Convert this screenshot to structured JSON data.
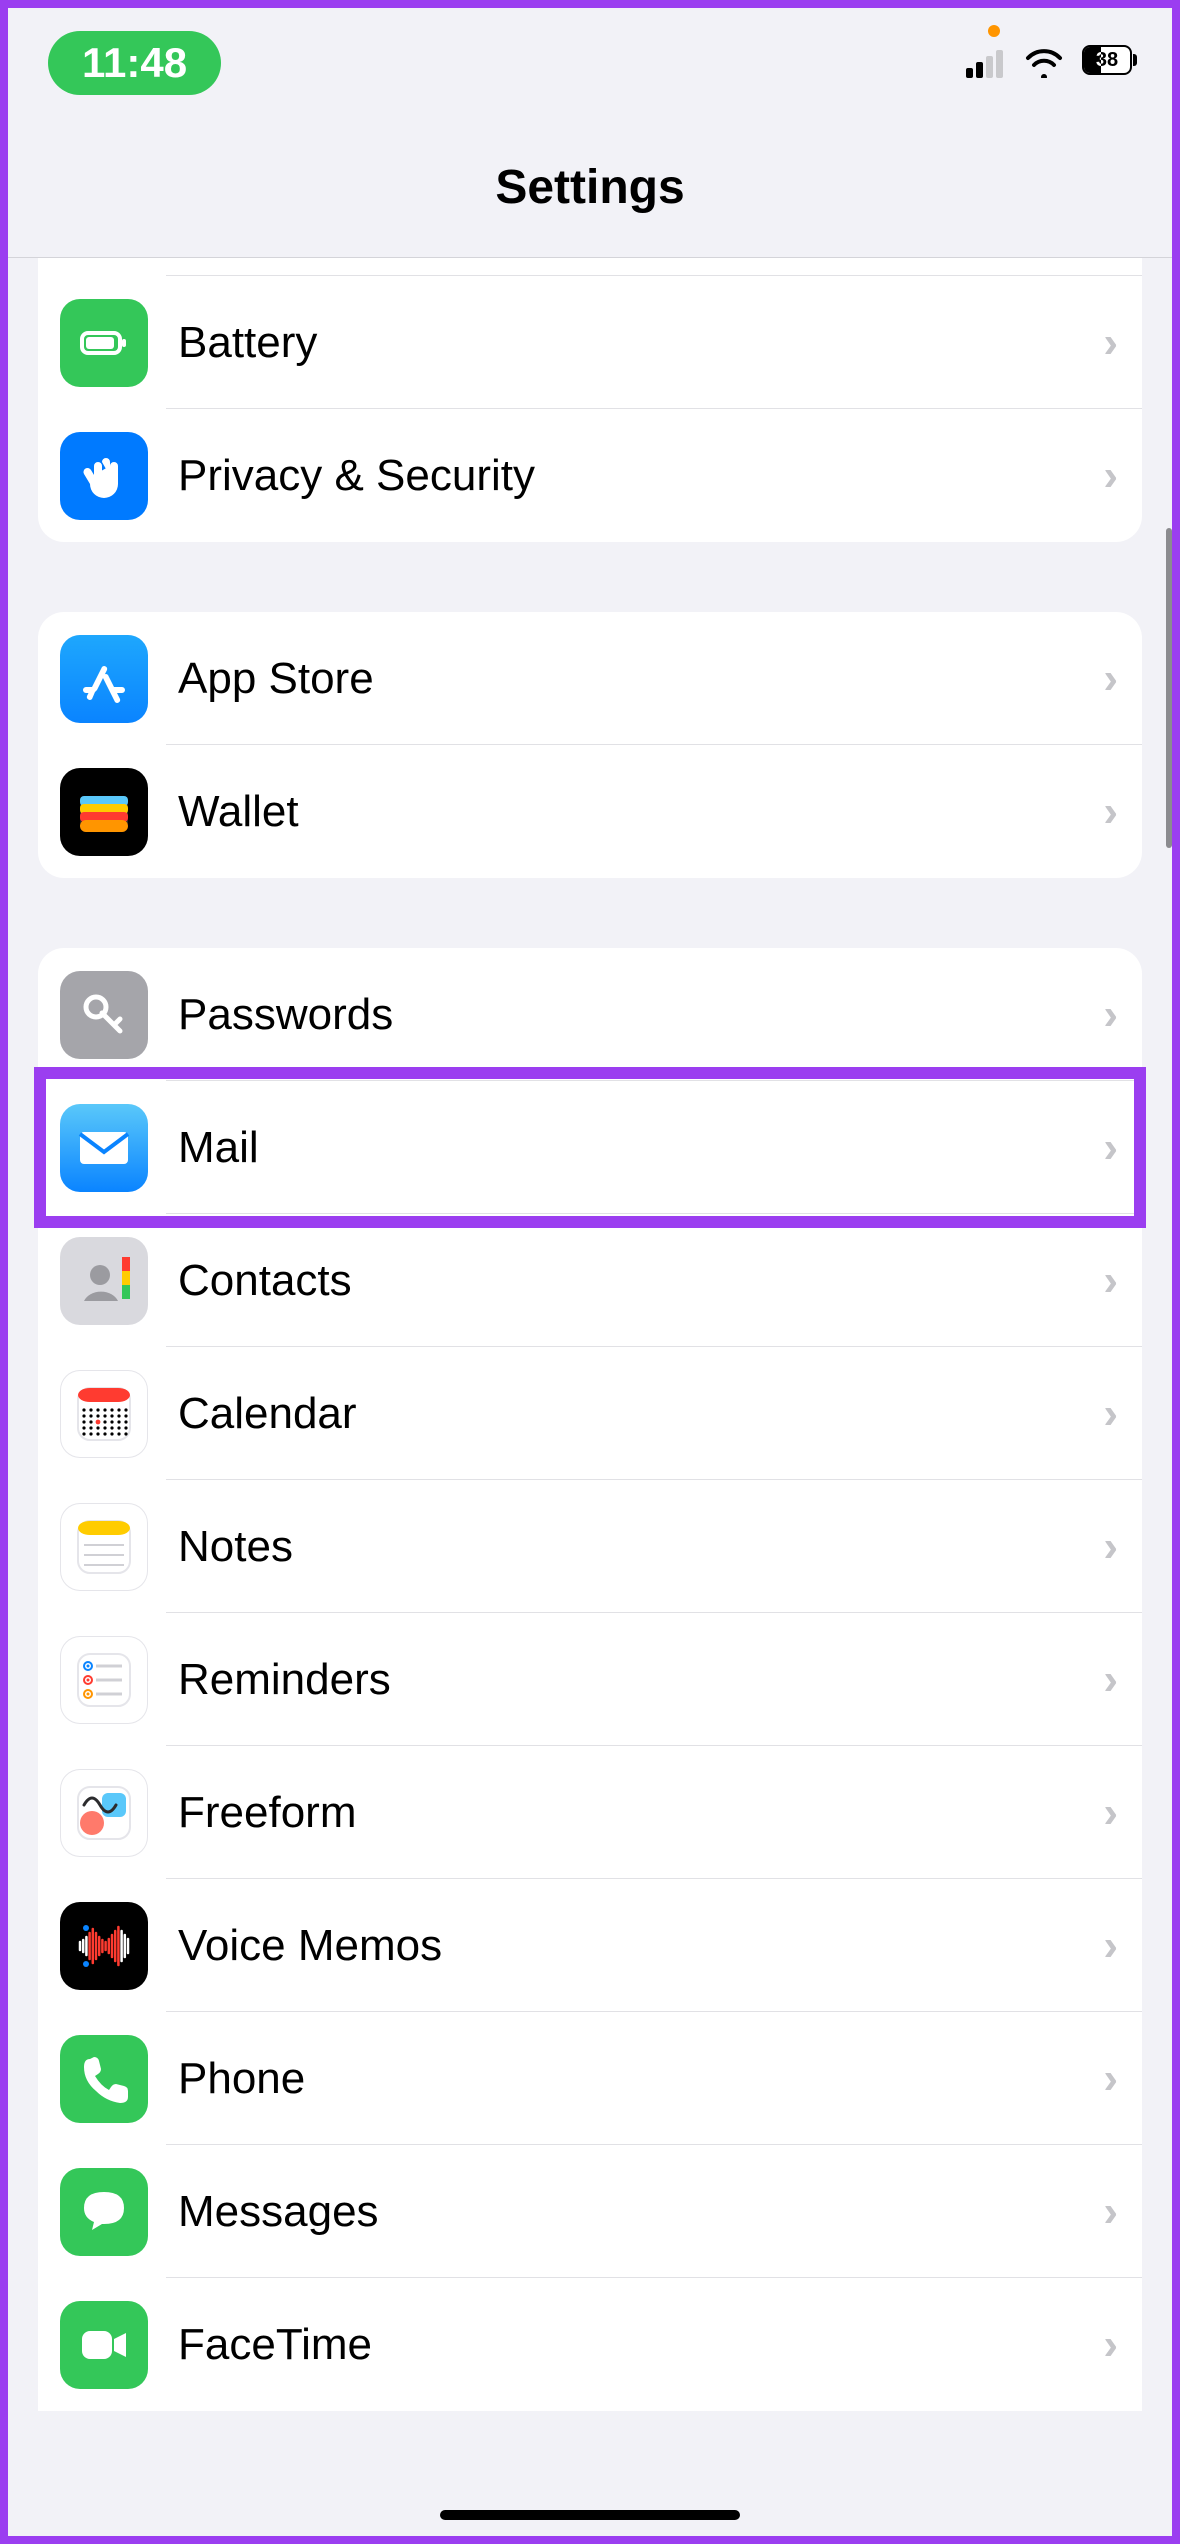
{
  "status": {
    "time": "11:48",
    "battery_pct": "38"
  },
  "header": {
    "title": "Settings"
  },
  "groups": [
    {
      "id": "system-bottom",
      "cut": "top",
      "rows": [
        {
          "key": "unknown-top",
          "label": "",
          "icon": "blank-icon",
          "bg": "#ffffff",
          "border": true
        },
        {
          "key": "battery",
          "label": "Battery",
          "icon": "battery-icon",
          "bg": "#34c759"
        },
        {
          "key": "privacy",
          "label": "Privacy & Security",
          "icon": "hand-icon",
          "bg": "#007aff"
        }
      ]
    },
    {
      "id": "store",
      "rows": [
        {
          "key": "app-store",
          "label": "App Store",
          "icon": "appstore-icon",
          "bg": "linear-gradient(180deg,#1ea7fd,#0a84ff)"
        },
        {
          "key": "wallet",
          "label": "Wallet",
          "icon": "wallet-icon",
          "bg": "#000000"
        }
      ]
    },
    {
      "id": "apps",
      "cut": "bottom",
      "rows": [
        {
          "key": "passwords",
          "label": "Passwords",
          "icon": "key-icon",
          "bg": "#a5a5aa"
        },
        {
          "key": "mail",
          "label": "Mail",
          "icon": "mail-icon",
          "bg": "linear-gradient(180deg,#5ac8fa,#0a84ff)",
          "highlight": true
        },
        {
          "key": "contacts",
          "label": "Contacts",
          "icon": "contacts-icon",
          "bg": "#d9d9de"
        },
        {
          "key": "calendar",
          "label": "Calendar",
          "icon": "calendar-icon",
          "bg": "#ffffff",
          "border": true
        },
        {
          "key": "notes",
          "label": "Notes",
          "icon": "notes-icon",
          "bg": "#ffffff",
          "border": true
        },
        {
          "key": "reminders",
          "label": "Reminders",
          "icon": "reminders-icon",
          "bg": "#ffffff",
          "border": true
        },
        {
          "key": "freeform",
          "label": "Freeform",
          "icon": "freeform-icon",
          "bg": "#ffffff",
          "border": true
        },
        {
          "key": "voicememos",
          "label": "Voice Memos",
          "icon": "voicememo-icon",
          "bg": "#000000"
        },
        {
          "key": "phone",
          "label": "Phone",
          "icon": "phone-icon",
          "bg": "#34c759"
        },
        {
          "key": "messages",
          "label": "Messages",
          "icon": "messages-icon",
          "bg": "#34c759"
        },
        {
          "key": "facetime",
          "label": "FaceTime",
          "icon": "facetime-icon",
          "bg": "#34c759"
        }
      ]
    }
  ]
}
